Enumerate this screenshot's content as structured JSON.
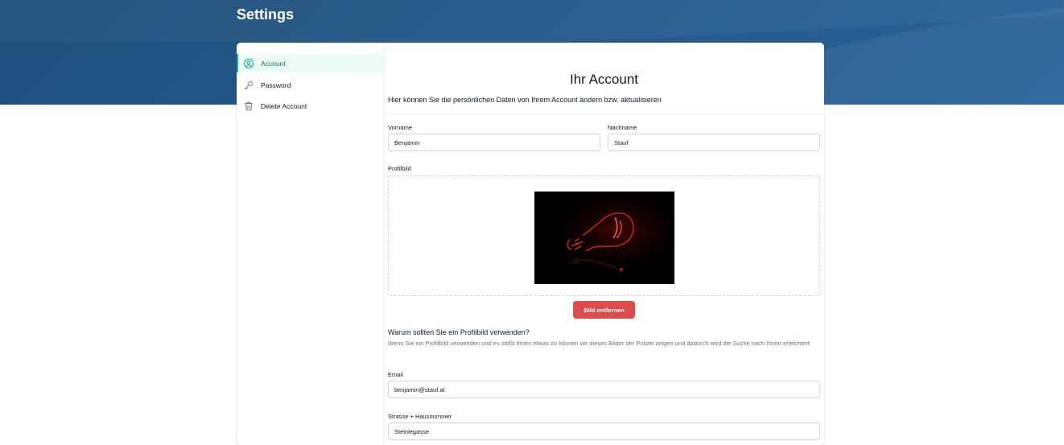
{
  "page": {
    "title": "Settings"
  },
  "sidebar": {
    "items": [
      {
        "label": "Account",
        "icon": "user-circle-icon",
        "active": true
      },
      {
        "label": "Password",
        "icon": "key-icon",
        "active": false
      },
      {
        "label": "Delete Account",
        "icon": "trash-icon",
        "active": false
      }
    ]
  },
  "account": {
    "title": "Ihr Account",
    "subtitle": "Hier können Sie die persönlichen Daten von Ihrem Account ändern bzw. aktualisieren",
    "firstname_label": "Vorname",
    "firstname_value": "Benjamin",
    "lastname_label": "Nachname",
    "lastname_value": "Stauf",
    "picture_label": "Profilbild",
    "remove_button": "Bild entfernen",
    "why_title": "Warum sollten Sie ein Profilbild verwenden?",
    "why_text": "Wenn Sie ein Profilbild verwenden und es stößt Ihnen etwas zu können wir dieses Bilder der Polizei zeigen und dadurch wird die Suche nach Ihnen erleichtert",
    "email_label": "Email",
    "email_value": "benjamin@stauf.at",
    "street_label": "Strasse + Hausnummer",
    "street_value": "Steinlegasse"
  },
  "colors": {
    "hero": "#235a8a",
    "accent": "#10b981",
    "danger": "#dc4c4a"
  }
}
